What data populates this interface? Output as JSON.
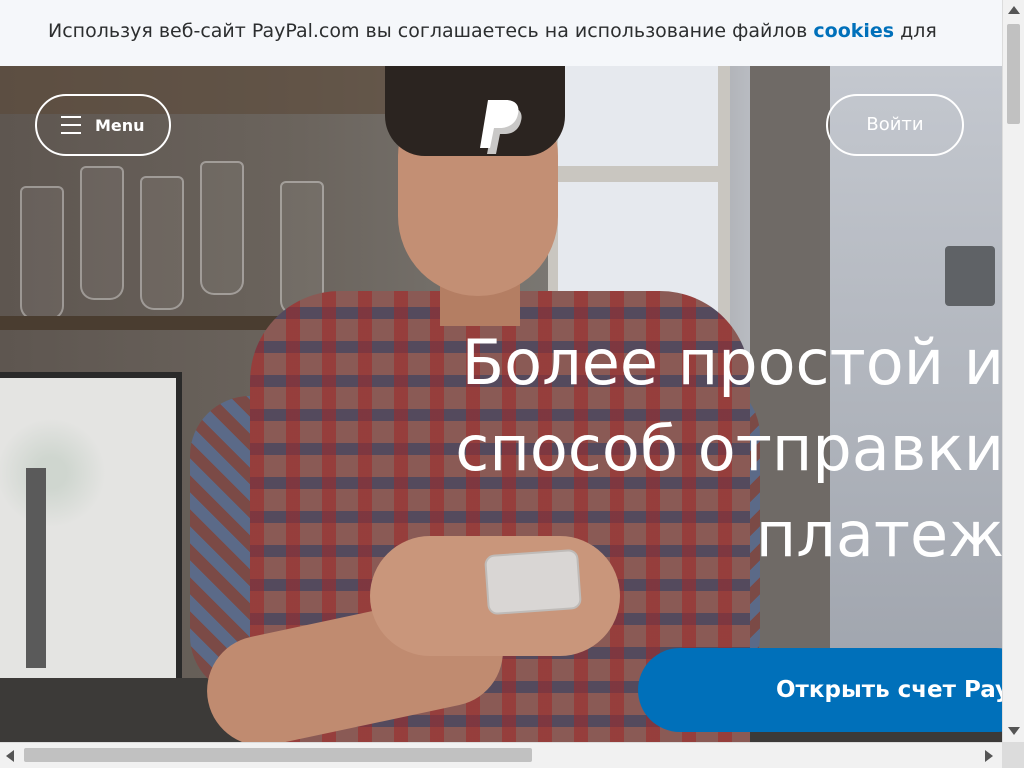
{
  "cookie_banner": {
    "text": "Используя веб-сайт PayPal.com вы соглашаетесь на использование файлов",
    "link": "cookies",
    "trailing": "для"
  },
  "header": {
    "menu_label": "Menu",
    "login_label": "Войти",
    "logo_icon": "paypal-logo-icon"
  },
  "hero": {
    "headline_lines": [
      "Более простой и",
      "способ отправки",
      "платеж"
    ],
    "cta_label": "Открыть счет PayPal"
  },
  "colors": {
    "brand_blue": "#0070ba",
    "banner_bg": "#f5f7fa",
    "white": "#ffffff"
  }
}
